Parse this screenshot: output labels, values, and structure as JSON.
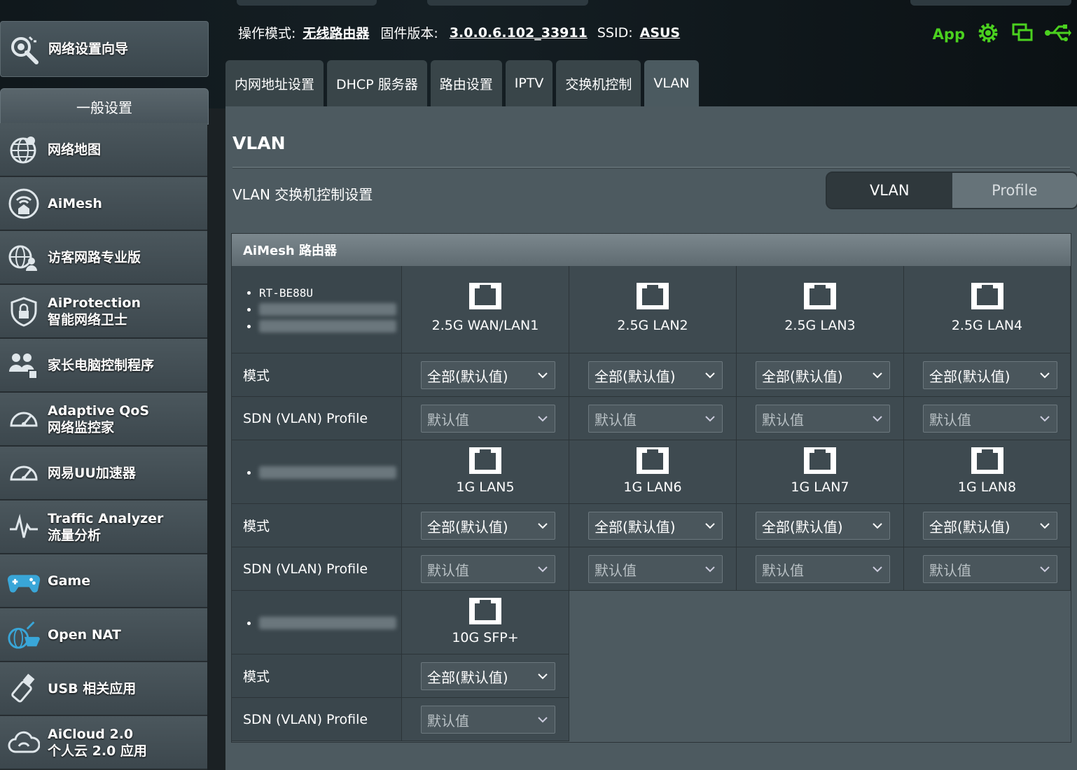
{
  "status": {
    "mode_label": "操作模式:",
    "mode_value": "无线路由器",
    "firmware_label": "固件版本:",
    "firmware_value": "3.0.0.6.102_33911",
    "ssid_label": "SSID:",
    "ssid_value": "ASUS",
    "app_label": "App"
  },
  "sidebar": {
    "wizard": "网络设置向导",
    "general": "一般设置",
    "items": [
      {
        "l1": "网络地图",
        "l2": "",
        "icon": "globe-icon"
      },
      {
        "l1": "AiMesh",
        "l2": "",
        "icon": "mesh-icon"
      },
      {
        "l1": "访客网路专业版",
        "l2": "",
        "icon": "guest-network-icon"
      },
      {
        "l1": "AiProtection",
        "l2": "智能网络卫士",
        "icon": "shield-lock-icon"
      },
      {
        "l1": "家长电脑控制程序",
        "l2": "",
        "icon": "parental-control-icon"
      },
      {
        "l1": "Adaptive QoS",
        "l2": "网络监控家",
        "icon": "gauge-icon"
      },
      {
        "l1": "网易UU加速器",
        "l2": "",
        "icon": "speedometer-icon"
      },
      {
        "l1": "Traffic Analyzer",
        "l2": "流量分析",
        "icon": "analyzer-icon"
      },
      {
        "l1": "Game",
        "l2": "",
        "icon": "gamepad-icon"
      },
      {
        "l1": "Open NAT",
        "l2": "",
        "icon": "open-nat-icon"
      },
      {
        "l1": "USB 相关应用",
        "l2": "",
        "icon": "usb-icon"
      },
      {
        "l1": "AiCloud 2.0",
        "l2": "个人云 2.0 应用",
        "icon": "cloud-icon"
      }
    ]
  },
  "tabs": [
    "内网地址设置",
    "DHCP 服务器",
    "路由设置",
    "IPTV",
    "交换机控制",
    "VLAN"
  ],
  "page": {
    "title": "VLAN",
    "subtitle": "VLAN 交换机控制设置",
    "seg_on": "VLAN",
    "seg_off": "Profile"
  },
  "table": {
    "header": "AiMesh 路由器",
    "device": "RT-BE88U",
    "row_mode": "模式",
    "row_profile": "SDN (VLAN) Profile",
    "mode_value": "全部(默认值)",
    "profile_value": "默认值",
    "ports_row1": [
      "2.5G WAN/LAN1",
      "2.5G LAN2",
      "2.5G LAN3",
      "2.5G LAN4"
    ],
    "ports_row2": [
      "1G LAN5",
      "1G LAN6",
      "1G LAN7",
      "1G LAN8"
    ],
    "ports_row3": [
      "10G SFP+"
    ]
  }
}
